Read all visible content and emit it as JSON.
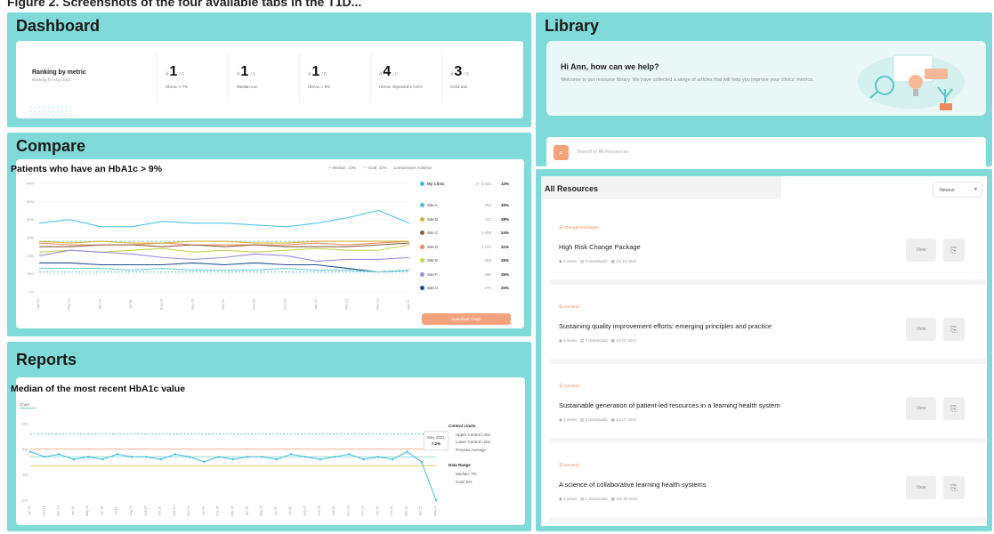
{
  "caption": "Figure 2. Screenshots of the four available tabs in the T1D...",
  "dashboard": {
    "title": "Dashboard",
    "ranking_title": "Ranking by metric",
    "ranking_sub": "Ranking for May 2021",
    "metrics": [
      {
        "rank": "1",
        "of": "/ 6",
        "label": "HbA1c < 7%"
      },
      {
        "rank": "1",
        "of": "/ 6",
        "label": "Median A1c"
      },
      {
        "rank": "1",
        "of": "/ 6",
        "label": "HbA1c > 9%"
      },
      {
        "rank": "4",
        "of": "/ 6",
        "label": "HbA1c improved ≥ 0.5%"
      },
      {
        "rank": "3",
        "of": "/ 6",
        "label": "CGM use"
      }
    ]
  },
  "compare": {
    "title": "Compare",
    "chart_title": "Patients who have an HbA1c > 9%",
    "legend_median": "— Median: 13%",
    "legend_goal": "--- Goal: 10%",
    "analysis_label": "Comparative Analysis",
    "my_clinic": {
      "name": "My Clinic",
      "count": "2 / 3,045",
      "pct": "12%",
      "color": "#3fb9e0"
    },
    "sites": [
      {
        "name": "Site A",
        "count": "202",
        "pct": "40%",
        "color": "#4fc3e8"
      },
      {
        "name": "Site B",
        "count": "112",
        "pct": "38%",
        "color": "#d4b43a"
      },
      {
        "name": "Site C",
        "count": "1,408",
        "pct": "24%",
        "color": "#8b5e3c"
      },
      {
        "name": "Site D",
        "count": "1,220",
        "pct": "31%",
        "color": "#f08a5d"
      },
      {
        "name": "Site E",
        "count": "350",
        "pct": "25%",
        "color": "#c5d44c"
      },
      {
        "name": "Site F",
        "count": "390",
        "pct": "35%",
        "color": "#9b8be0"
      },
      {
        "name": "Site G",
        "count": "273",
        "pct": "20%",
        "color": "#1f4f8a"
      }
    ],
    "button_label": "Download Graph"
  },
  "reports": {
    "title": "Reports",
    "chart_title": "Median of the most recent HbA1c value",
    "tab": "Chart",
    "tooltip": {
      "date": "May 2021",
      "value": "7.2%"
    },
    "legend": {
      "control_limits": "Control Limits",
      "ucl": "Upper Control Limit",
      "lcl": "Lower Control Limit",
      "process_avg": "Process Average",
      "data_range": "Data Range",
      "median": "Median: 7%",
      "goal": "Goal: 6%"
    }
  },
  "library": {
    "title": "Library",
    "greeting": "Hi Ann, how can we help?",
    "greeting_sub": "Welcome to our resource library. We have collected a range of articles that will help you improve your clinics' metrics.",
    "search_placeholder": "Search in All Resources",
    "search_icon": "search-icon"
  },
  "resources": {
    "title": "All Resources",
    "sort": "Newest",
    "view_label": "View",
    "items": [
      {
        "category": "Change Packages",
        "title": "High Risk Change Package",
        "views": "5 views",
        "downloads": "0 downloads",
        "date": "Jul 16 2021"
      },
      {
        "category": "General",
        "title": "Sustaining quality improvement efforts: emerging principles and practice",
        "views": "5 views",
        "downloads": "0 downloads",
        "date": "Jul 07 2021"
      },
      {
        "category": "General",
        "title": "Sustainable generation of patient-led resources in a learning health system",
        "views": "5 views",
        "downloads": "0 downloads",
        "date": "Jul 07 2021"
      },
      {
        "category": "General",
        "title": "A science of collaborative learning health systems",
        "views": "1 views",
        "downloads": "1 downloads",
        "date": "Jun 09 2021"
      }
    ]
  },
  "chart_data": [
    {
      "type": "line",
      "title": "Patients who have an HbA1c > 9%",
      "categories": [
        "Apr 20",
        "May 20",
        "Jun 20",
        "Jul 20",
        "Aug 20",
        "Sep 20",
        "Oct 20",
        "Nov 20",
        "Dec 20",
        "Jan 21",
        "Feb 21",
        "Mar 21",
        "Apr 21"
      ],
      "ylim": [
        0,
        60
      ],
      "series": [
        {
          "name": "Site A",
          "color": "#4fc3e8",
          "values": [
            38,
            40,
            36,
            36,
            39,
            38,
            38,
            37,
            36,
            38,
            41,
            45,
            38
          ]
        },
        {
          "name": "Site D",
          "color": "#f08a5d",
          "values": [
            27,
            26,
            26,
            26,
            27,
            26,
            26,
            26,
            26,
            27,
            26,
            27,
            28
          ]
        },
        {
          "name": "Site C",
          "color": "#8b5e3c",
          "values": [
            25,
            25,
            26,
            26,
            25,
            26,
            25,
            26,
            25,
            25,
            25,
            26,
            27
          ]
        },
        {
          "name": "Site B",
          "color": "#d4b43a",
          "values": [
            28,
            27,
            28,
            27,
            27,
            28,
            28,
            27,
            27,
            28,
            28,
            28,
            28
          ]
        },
        {
          "name": "Site E",
          "color": "#c5d44c",
          "values": [
            22,
            23,
            22,
            23,
            24,
            22,
            23,
            22,
            23,
            24,
            23,
            23,
            26
          ]
        },
        {
          "name": "Site F",
          "color": "#9b8be0",
          "values": [
            20,
            23,
            22,
            21,
            19,
            18,
            19,
            21,
            20,
            17,
            18,
            18,
            19
          ]
        },
        {
          "name": "Site G",
          "color": "#1f4f8a",
          "values": [
            16,
            16,
            15,
            15,
            15,
            16,
            15,
            16,
            15,
            15,
            13,
            11,
            12
          ]
        },
        {
          "name": "My Clinic",
          "color": "#6fd0d0",
          "values": [
            13,
            13,
            13,
            12,
            13,
            12,
            12,
            12,
            13,
            12,
            12,
            11,
            12
          ]
        }
      ],
      "median": 28,
      "goal": 11
    },
    {
      "type": "line",
      "title": "Median of the most recent HbA1c value",
      "categories": [
        "Jan 19",
        "Feb 19",
        "Mar 19",
        "Apr 19",
        "May 19",
        "Jun 19",
        "Jul 19",
        "Aug 19",
        "Sep 19",
        "Oct 19",
        "Nov 19",
        "Dec 19",
        "Jan 20",
        "Feb 20",
        "Mar 20",
        "Apr 20",
        "May 20",
        "Jun 20",
        "Jul 20",
        "Aug 20",
        "Sep 20",
        "Oct 20",
        "Nov 20",
        "Dec 20",
        "Jan 21",
        "Feb 21",
        "Mar 21",
        "Apr 21",
        "May 21"
      ],
      "ylim": [
        6,
        9
      ],
      "series": [
        {
          "name": "Median",
          "color": "#3fb9e0",
          "values": [
            7.9,
            7.7,
            7.8,
            7.6,
            7.7,
            7.6,
            7.8,
            7.7,
            7.7,
            7.6,
            7.8,
            7.7,
            7.5,
            7.7,
            7.6,
            7.7,
            7.7,
            7.6,
            7.8,
            7.7,
            7.6,
            7.7,
            7.8,
            7.6,
            7.7,
            7.6,
            7.9,
            7.5,
            6.0
          ]
        }
      ],
      "upper_control_limit": 8.0,
      "lower_control_limit": 7.35,
      "process_average": 7.7,
      "goal": 8.6
    }
  ]
}
